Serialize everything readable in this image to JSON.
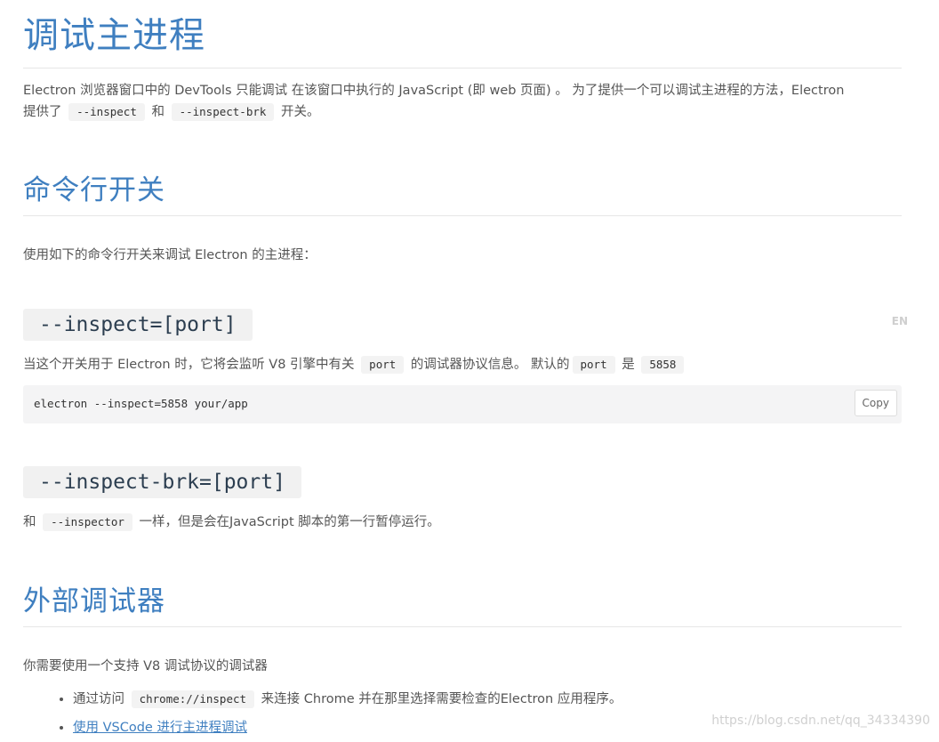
{
  "title": "调试主进程",
  "intro": {
    "line1": "Electron 浏览器窗口中的 DevTools 只能调试 在该窗口中执行的 JavaScript (即 web 页面) 。 为了提供一个可以调试主进程的方法，Electron",
    "line2_prefix": "提供了",
    "code_inspect": "--inspect",
    "line2_mid": "和",
    "code_inspect_brk": "--inspect-brk",
    "line2_suffix": "开关。"
  },
  "section_cli": {
    "heading": "命令行开关",
    "description": "使用如下的命令行开关来调试 Electron 的主进程："
  },
  "flag_inspect": {
    "heading": "--inspect=[port]",
    "lang_tag": "EN",
    "desc_prefix": "当这个开关用于 Electron 时，它将会监听 V8 引擎中有关",
    "code_port": "port",
    "desc_mid1": "的调试器协议信息。 默认的",
    "code_port2": "port",
    "desc_mid2": "是",
    "code_default": "5858",
    "code_block": "electron --inspect=5858 your/app",
    "copy_label": "Copy"
  },
  "flag_inspect_brk": {
    "heading": "--inspect-brk=[port]",
    "desc_prefix": "和",
    "code_inspector": "--inspector",
    "desc_suffix": "一样，但是会在JavaScript 脚本的第一行暂停运行。"
  },
  "section_external": {
    "heading": "外部调试器",
    "description": "你需要使用一个支持 V8 调试协议的调试器",
    "items": [
      {
        "prefix": "通过访问",
        "code": "chrome://inspect",
        "suffix": "来连接 Chrome 并在那里选择需要检查的Electron 应用程序。"
      },
      {
        "link": "使用 VSCode 进行主进程调试"
      }
    ]
  },
  "watermark": "https://blog.csdn.net/qq_34334390"
}
